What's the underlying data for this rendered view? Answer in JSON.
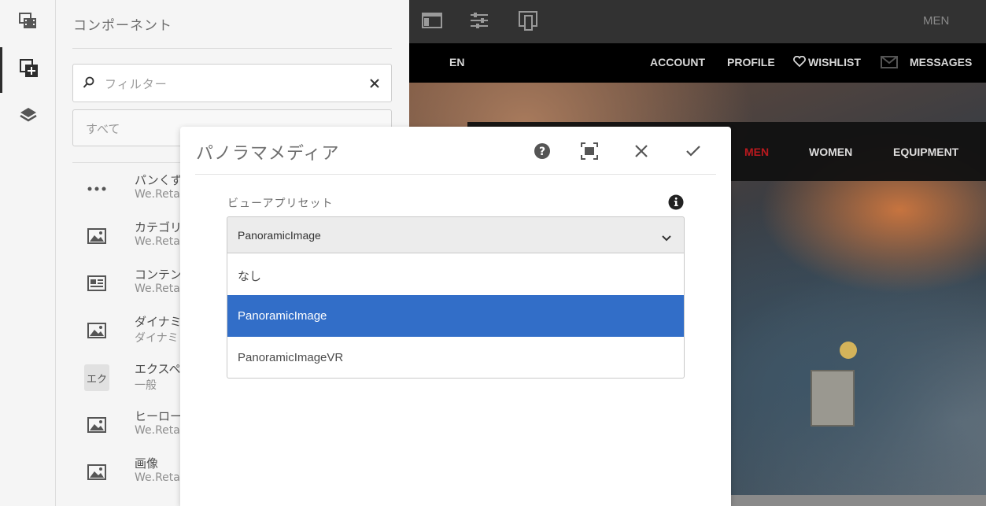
{
  "rail": {
    "items": [
      {
        "name": "assets-icon"
      },
      {
        "name": "components-icon"
      },
      {
        "name": "layers-icon"
      }
    ]
  },
  "panel": {
    "title": "コンポーネント",
    "search": {
      "placeholder": "フィルター"
    },
    "group_value": "すべて",
    "components": [
      {
        "title": "パンくず",
        "sub": "We.Retai",
        "icon": "ellipsis-icon"
      },
      {
        "title": "カテゴリ",
        "sub": "We.Retai",
        "icon": "image-icon"
      },
      {
        "title": "コンテン",
        "sub": "We.Retai",
        "icon": "content-card-icon"
      },
      {
        "title": "ダイナミ",
        "sub": "ダイナミ",
        "icon": "image-icon"
      },
      {
        "title": "エクスペ",
        "sub": "一般",
        "badge": "エク"
      },
      {
        "title": "ヒーロー",
        "sub": "We.Retai",
        "icon": "image-icon"
      },
      {
        "title": "画像",
        "sub": "We.Retai",
        "icon": "image-icon"
      }
    ]
  },
  "site": {
    "toolbar": {
      "men_label": "MEN"
    },
    "nav1": {
      "lang": "EN",
      "account": "ACCOUNT",
      "profile": "PROFILE",
      "wishlist": "WISHLIST",
      "messages": "MESSAGES"
    },
    "nav2": {
      "men": "MEN",
      "women": "WOMEN",
      "equipment": "EQUIPMENT"
    }
  },
  "dialog": {
    "title": "パノラマメディア",
    "field_label": "ビューアプリセット",
    "selected_value": "PanoramicImage",
    "options": [
      "なし",
      "PanoramicImage",
      "PanoramicImageVR"
    ],
    "selected_index": 1
  },
  "colors": {
    "accent": "#326ec8",
    "nav_active": "#c0171d"
  }
}
